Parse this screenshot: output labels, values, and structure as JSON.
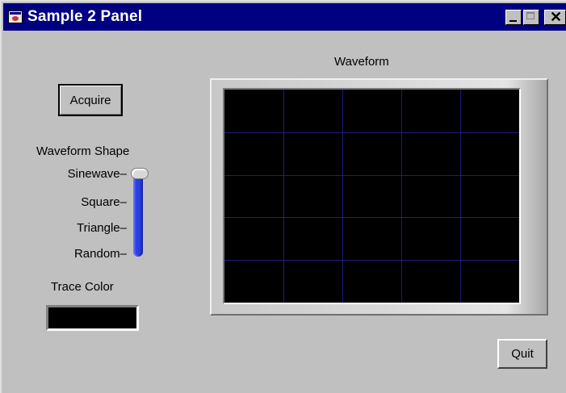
{
  "window": {
    "title": "Sample 2 Panel",
    "titlebar_color": "#000080",
    "icon": "labview-vi-icon",
    "controls": [
      "minimize-icon",
      "maximize-icon",
      "close-icon"
    ],
    "close_glyph": "✕"
  },
  "acquire_button": {
    "label": "Acquire"
  },
  "waveform_shape": {
    "label": "Waveform Shape",
    "options": [
      "Sinewave",
      "Square",
      "Triangle",
      "Random"
    ],
    "selected": "Sinewave",
    "slider_color": "#2a3fe0"
  },
  "trace_color": {
    "label": "Trace Color",
    "value_color": "#000000"
  },
  "graph": {
    "title": "Waveform",
    "background": "#000000",
    "grid_color": "#1c1c7a",
    "grid_divisions": {
      "columns": 5,
      "rows": 5
    }
  },
  "quit_button": {
    "label": "Quit"
  }
}
